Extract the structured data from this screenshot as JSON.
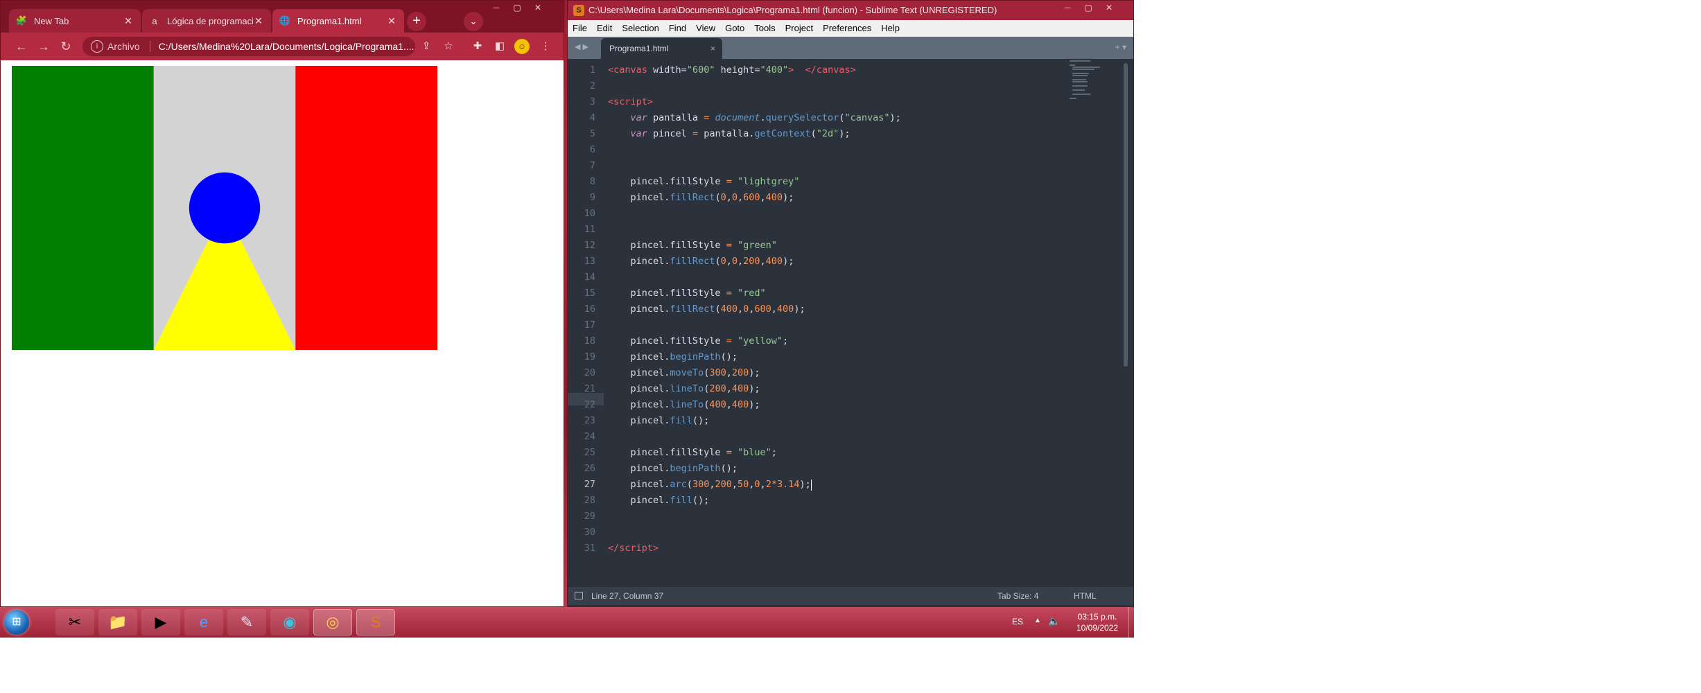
{
  "chrome": {
    "tabs": [
      {
        "title": "New Tab",
        "icon": "puzzle-icon",
        "close": "✕"
      },
      {
        "title": "Lógica de programación",
        "icon": "alura-icon",
        "close": "✕"
      },
      {
        "title": "Programa1.html",
        "icon": "globe-icon",
        "close": "✕",
        "active": true
      }
    ],
    "new_tab": "+",
    "address": {
      "scheme": "Archivo",
      "url": "C:/Users/Medina%20Lara/Documents/Logica/Programa1...."
    }
  },
  "flag": {
    "colors": {
      "left": "#008000",
      "middle": "#d3d3d3",
      "right": "#ff0000",
      "triangle": "#ffff00",
      "circle": "#0000ff"
    }
  },
  "sublime": {
    "title": "C:\\Users\\Medina Lara\\Documents\\Logica\\Programa1.html (funcion) - Sublime Text (UNREGISTERED)",
    "menu": [
      "File",
      "Edit",
      "Selection",
      "Find",
      "View",
      "Goto",
      "Tools",
      "Project",
      "Preferences",
      "Help"
    ],
    "tab": {
      "title": "Programa1.html",
      "close": "×"
    },
    "current_line": 27,
    "status": {
      "position": "Line 27, Column 37",
      "tab_size": "Tab Size: 4",
      "syntax": "HTML"
    }
  },
  "taskbar": {
    "items": [
      "start-orb",
      "sniping-tool-icon",
      "file-explorer-icon",
      "media-player-icon",
      "internet-explorer-icon",
      "feather-icon",
      "edge-icon",
      "chrome-icon",
      "sublime-icon"
    ],
    "language": "ES",
    "time": "03:15 p.m.",
    "date": "10/09/2022"
  }
}
